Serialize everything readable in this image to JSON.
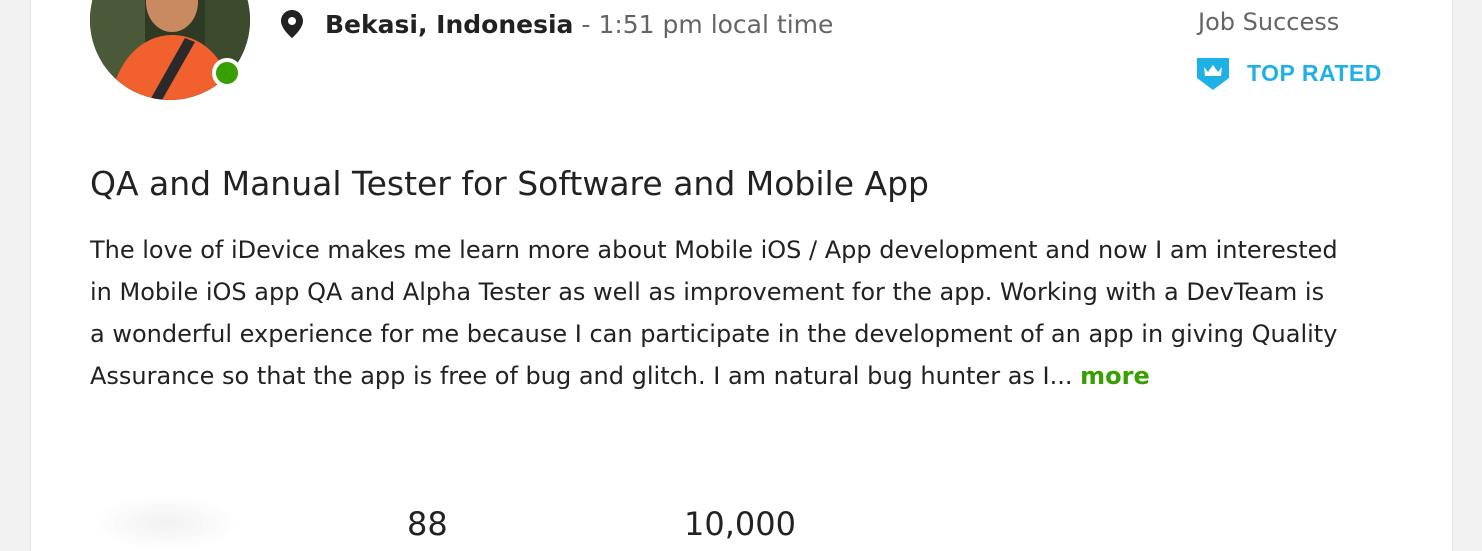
{
  "profile": {
    "location": "Bekasi, Indonesia",
    "separator": "-",
    "local_time": "1:51 pm local time",
    "online": true
  },
  "job_success": {
    "label": "Job Success"
  },
  "badge": {
    "label": "TOP RATED",
    "icon": "top-rated-shield-icon",
    "color": "#1fb1e6"
  },
  "title": "QA and Manual Tester for Software and Mobile App",
  "description": {
    "text": "The love of iDevice makes me learn more about Mobile iOS / App development and now I am interested in Mobile iOS app QA and Alpha Tester as well as improvement for the app. Working with a DevTeam is a wonderful experience for me because I can participate in the development of an app in giving Quality Assurance so that the app is free of bug and glitch. I am natural bug hunter as I...",
    "more_label": "more"
  },
  "stats": {
    "first": "88",
    "second": "10,000"
  },
  "colors": {
    "accent_green": "#37a000",
    "accent_blue": "#1fb1e6",
    "text": "#222222",
    "muted": "#656565"
  }
}
